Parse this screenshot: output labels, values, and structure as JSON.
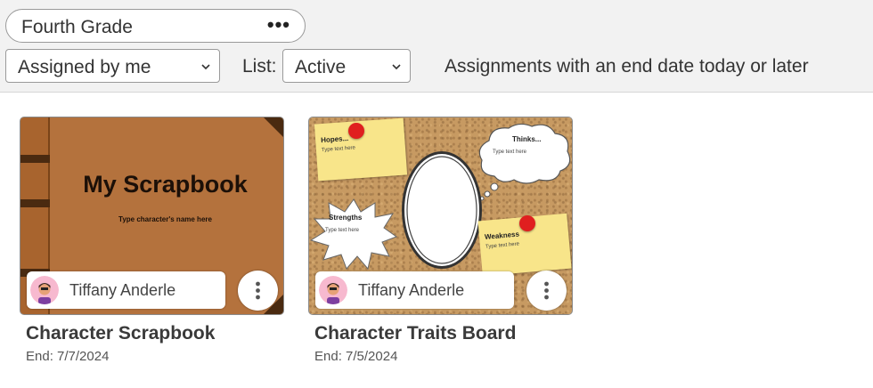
{
  "header": {
    "class_name": "Fourth Grade",
    "class_menu_icon": "more-horizontal-icon",
    "assigned_filter": "Assigned by me",
    "list_label": "List:",
    "list_filter": "Active",
    "hint": "Assignments with an end date today or later"
  },
  "assignments": [
    {
      "title": "Character Scrapbook",
      "end": "End: 7/7/2024",
      "owner": "Tiffany Anderle",
      "thumb": {
        "heading": "My Scrapbook",
        "sub": "Type character's name here"
      }
    },
    {
      "title": "Character Traits Board",
      "end": "End: 7/5/2024",
      "owner": "Tiffany Anderle",
      "thumb": {
        "hopes": "Hopes...",
        "hopes_sub": "Type text here",
        "thinks": "Thinks...",
        "thinks_sub": "Type text here",
        "strengths": "Strengths",
        "strengths_sub": "Type text here",
        "weakness": "Weakness",
        "weakness_sub": "Type text here"
      }
    }
  ],
  "colors": {
    "topbar_bg": "#f2f2f2",
    "scrapbook_cover": "#b4723d",
    "corkboard": "#c79a62",
    "sticky_note": "#f8e58a",
    "pin": "#e01f1f"
  }
}
